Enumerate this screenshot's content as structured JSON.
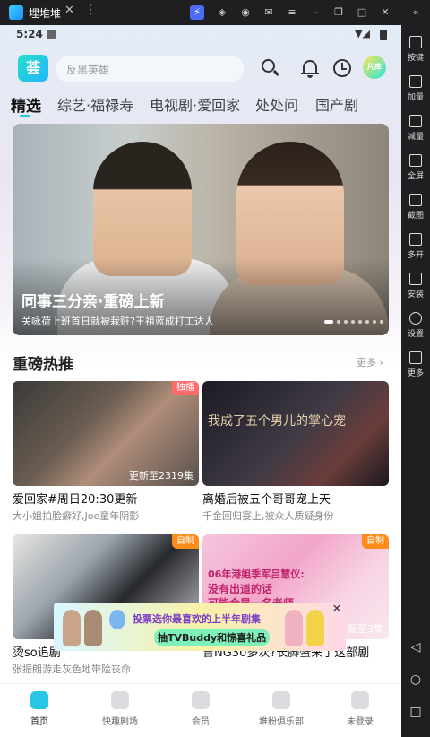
{
  "emulator": {
    "app_title": "埋堆堆",
    "sidebar": [
      {
        "label": "按键",
        "icon": "keyboard-icon"
      },
      {
        "label": "加量",
        "icon": "volume-up-icon"
      },
      {
        "label": "减量",
        "icon": "volume-down-icon"
      },
      {
        "label": "全屏",
        "icon": "fullscreen-icon"
      },
      {
        "label": "截图",
        "icon": "scissors-icon"
      },
      {
        "label": "多开",
        "icon": "multi-instance-icon"
      },
      {
        "label": "安装",
        "icon": "apk-install-icon"
      },
      {
        "label": "设置",
        "icon": "gear-icon"
      },
      {
        "label": "更多",
        "icon": "more-icon"
      }
    ]
  },
  "status": {
    "time": "5:24"
  },
  "header": {
    "logo_text": "荟",
    "search_placeholder": "反黑英雄",
    "avatar_text": "片库"
  },
  "tabs": [
    "精选",
    "综艺·福禄寿",
    "电视剧·爱回家",
    "处处问",
    "国产剧"
  ],
  "banner": {
    "title": "同事三分亲·重磅上新",
    "subtitle": "关咏荷上班首日就被栽赃?王祖蓝成打工达人"
  },
  "section": {
    "title": "重磅热推",
    "more": "更多"
  },
  "cards": [
    {
      "title": "爱回家#周日20:30更新",
      "subtitle": "大小姐拍脸癖好,Joe童年阴影",
      "badge": "独播",
      "badge_color": "#ff6a6a",
      "caption": "更新至2319集",
      "thumb_text": ""
    },
    {
      "title": "离婚后被五个哥哥宠上天",
      "subtitle": "千金回归宴上,被众人质疑身份",
      "badge": "",
      "badge_color": "",
      "caption": "",
      "thumb_text": "我成了五个男儿的掌心宠"
    },
    {
      "title": "烫so追剧",
      "subtitle": "张振朗游走灰色地带险丧命",
      "badge": "自制",
      "badge_color": "#ff8c1a",
      "caption": "",
      "thumb_text": ""
    },
    {
      "title": "曾NG30多次?长脚蟹来了这部剧",
      "subtitle": "",
      "badge": "自制",
      "badge_color": "#ff8c1a",
      "caption": "新至3集",
      "thumb_text": "06年港姐季军吕慧仪:",
      "thumb_text2": "没有出道的话",
      "thumb_text3": "可能会是一名老师"
    }
  ],
  "promo": {
    "line1": "投票选你最喜欢的上半年剧集",
    "line2": "抽TVBuddy和惊喜礼品"
  },
  "bottom_nav": [
    "首页",
    "快趣剧场",
    "会员",
    "堆粉俱乐部",
    "未登录"
  ]
}
